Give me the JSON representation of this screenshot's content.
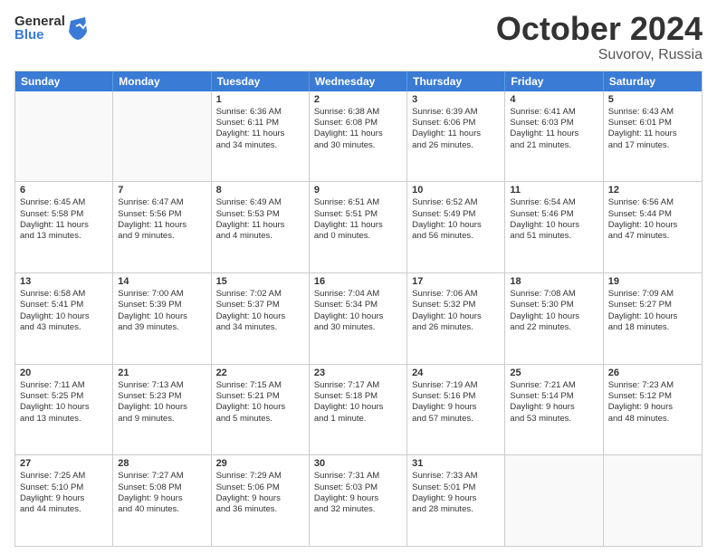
{
  "logo": {
    "general": "General",
    "blue": "Blue"
  },
  "title": "October 2024",
  "location": "Suvorov, Russia",
  "days": [
    "Sunday",
    "Monday",
    "Tuesday",
    "Wednesday",
    "Thursday",
    "Friday",
    "Saturday"
  ],
  "weeks": [
    [
      {
        "day": "",
        "lines": []
      },
      {
        "day": "",
        "lines": []
      },
      {
        "day": "1",
        "lines": [
          "Sunrise: 6:36 AM",
          "Sunset: 6:11 PM",
          "Daylight: 11 hours",
          "and 34 minutes."
        ]
      },
      {
        "day": "2",
        "lines": [
          "Sunrise: 6:38 AM",
          "Sunset: 6:08 PM",
          "Daylight: 11 hours",
          "and 30 minutes."
        ]
      },
      {
        "day": "3",
        "lines": [
          "Sunrise: 6:39 AM",
          "Sunset: 6:06 PM",
          "Daylight: 11 hours",
          "and 26 minutes."
        ]
      },
      {
        "day": "4",
        "lines": [
          "Sunrise: 6:41 AM",
          "Sunset: 6:03 PM",
          "Daylight: 11 hours",
          "and 21 minutes."
        ]
      },
      {
        "day": "5",
        "lines": [
          "Sunrise: 6:43 AM",
          "Sunset: 6:01 PM",
          "Daylight: 11 hours",
          "and 17 minutes."
        ]
      }
    ],
    [
      {
        "day": "6",
        "lines": [
          "Sunrise: 6:45 AM",
          "Sunset: 5:58 PM",
          "Daylight: 11 hours",
          "and 13 minutes."
        ]
      },
      {
        "day": "7",
        "lines": [
          "Sunrise: 6:47 AM",
          "Sunset: 5:56 PM",
          "Daylight: 11 hours",
          "and 9 minutes."
        ]
      },
      {
        "day": "8",
        "lines": [
          "Sunrise: 6:49 AM",
          "Sunset: 5:53 PM",
          "Daylight: 11 hours",
          "and 4 minutes."
        ]
      },
      {
        "day": "9",
        "lines": [
          "Sunrise: 6:51 AM",
          "Sunset: 5:51 PM",
          "Daylight: 11 hours",
          "and 0 minutes."
        ]
      },
      {
        "day": "10",
        "lines": [
          "Sunrise: 6:52 AM",
          "Sunset: 5:49 PM",
          "Daylight: 10 hours",
          "and 56 minutes."
        ]
      },
      {
        "day": "11",
        "lines": [
          "Sunrise: 6:54 AM",
          "Sunset: 5:46 PM",
          "Daylight: 10 hours",
          "and 51 minutes."
        ]
      },
      {
        "day": "12",
        "lines": [
          "Sunrise: 6:56 AM",
          "Sunset: 5:44 PM",
          "Daylight: 10 hours",
          "and 47 minutes."
        ]
      }
    ],
    [
      {
        "day": "13",
        "lines": [
          "Sunrise: 6:58 AM",
          "Sunset: 5:41 PM",
          "Daylight: 10 hours",
          "and 43 minutes."
        ]
      },
      {
        "day": "14",
        "lines": [
          "Sunrise: 7:00 AM",
          "Sunset: 5:39 PM",
          "Daylight: 10 hours",
          "and 39 minutes."
        ]
      },
      {
        "day": "15",
        "lines": [
          "Sunrise: 7:02 AM",
          "Sunset: 5:37 PM",
          "Daylight: 10 hours",
          "and 34 minutes."
        ]
      },
      {
        "day": "16",
        "lines": [
          "Sunrise: 7:04 AM",
          "Sunset: 5:34 PM",
          "Daylight: 10 hours",
          "and 30 minutes."
        ]
      },
      {
        "day": "17",
        "lines": [
          "Sunrise: 7:06 AM",
          "Sunset: 5:32 PM",
          "Daylight: 10 hours",
          "and 26 minutes."
        ]
      },
      {
        "day": "18",
        "lines": [
          "Sunrise: 7:08 AM",
          "Sunset: 5:30 PM",
          "Daylight: 10 hours",
          "and 22 minutes."
        ]
      },
      {
        "day": "19",
        "lines": [
          "Sunrise: 7:09 AM",
          "Sunset: 5:27 PM",
          "Daylight: 10 hours",
          "and 18 minutes."
        ]
      }
    ],
    [
      {
        "day": "20",
        "lines": [
          "Sunrise: 7:11 AM",
          "Sunset: 5:25 PM",
          "Daylight: 10 hours",
          "and 13 minutes."
        ]
      },
      {
        "day": "21",
        "lines": [
          "Sunrise: 7:13 AM",
          "Sunset: 5:23 PM",
          "Daylight: 10 hours",
          "and 9 minutes."
        ]
      },
      {
        "day": "22",
        "lines": [
          "Sunrise: 7:15 AM",
          "Sunset: 5:21 PM",
          "Daylight: 10 hours",
          "and 5 minutes."
        ]
      },
      {
        "day": "23",
        "lines": [
          "Sunrise: 7:17 AM",
          "Sunset: 5:18 PM",
          "Daylight: 10 hours",
          "and 1 minute."
        ]
      },
      {
        "day": "24",
        "lines": [
          "Sunrise: 7:19 AM",
          "Sunset: 5:16 PM",
          "Daylight: 9 hours",
          "and 57 minutes."
        ]
      },
      {
        "day": "25",
        "lines": [
          "Sunrise: 7:21 AM",
          "Sunset: 5:14 PM",
          "Daylight: 9 hours",
          "and 53 minutes."
        ]
      },
      {
        "day": "26",
        "lines": [
          "Sunrise: 7:23 AM",
          "Sunset: 5:12 PM",
          "Daylight: 9 hours",
          "and 48 minutes."
        ]
      }
    ],
    [
      {
        "day": "27",
        "lines": [
          "Sunrise: 7:25 AM",
          "Sunset: 5:10 PM",
          "Daylight: 9 hours",
          "and 44 minutes."
        ]
      },
      {
        "day": "28",
        "lines": [
          "Sunrise: 7:27 AM",
          "Sunset: 5:08 PM",
          "Daylight: 9 hours",
          "and 40 minutes."
        ]
      },
      {
        "day": "29",
        "lines": [
          "Sunrise: 7:29 AM",
          "Sunset: 5:06 PM",
          "Daylight: 9 hours",
          "and 36 minutes."
        ]
      },
      {
        "day": "30",
        "lines": [
          "Sunrise: 7:31 AM",
          "Sunset: 5:03 PM",
          "Daylight: 9 hours",
          "and 32 minutes."
        ]
      },
      {
        "day": "31",
        "lines": [
          "Sunrise: 7:33 AM",
          "Sunset: 5:01 PM",
          "Daylight: 9 hours",
          "and 28 minutes."
        ]
      },
      {
        "day": "",
        "lines": []
      },
      {
        "day": "",
        "lines": []
      }
    ]
  ]
}
